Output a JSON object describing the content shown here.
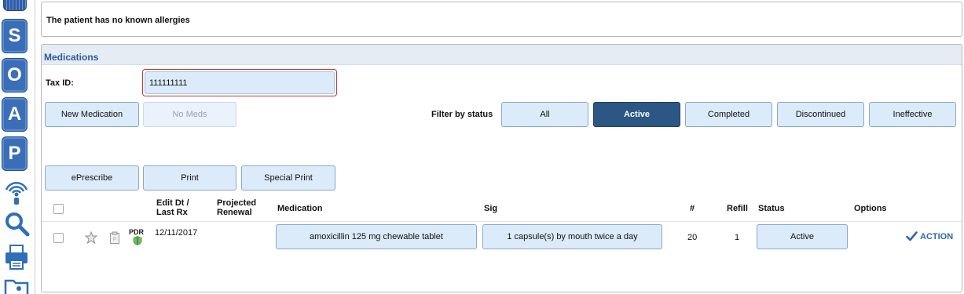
{
  "rail": {
    "soap_letters": [
      "S",
      "O",
      "A",
      "P"
    ],
    "icons": [
      "signal-icon",
      "search-icon",
      "printer-icon",
      "folder-icon"
    ]
  },
  "allergy": {
    "text": "The patient has no known allergies"
  },
  "medications": {
    "title": "Medications",
    "tax_id_label": "Tax ID:",
    "tax_id_value": "111111111",
    "buttons": {
      "new_medication": "New Medication",
      "no_meds": "No Meds",
      "eprescribe": "ePrescribe",
      "print": "Print",
      "special_print": "Special Print"
    },
    "filter": {
      "label": "Filter by status",
      "options": [
        "All",
        "Active",
        "Completed",
        "Discontinued",
        "Ineffective"
      ],
      "selected": "Active"
    },
    "table": {
      "headers": {
        "edit_dt": "Edit Dt /",
        "last_rx": "Last Rx",
        "projected": "Projected",
        "renewal": "Renewal",
        "medication": "Medication",
        "sig": "Sig",
        "count": "#",
        "refill": "Refill",
        "status": "Status",
        "options": "Options"
      },
      "rows": [
        {
          "pdr_label": "PDR",
          "edit_date": "12/11/2017",
          "projected_renewal": "",
          "medication": "amoxicillin 125 mg chewable tablet",
          "sig": "1 capsule(s) by mouth twice a day",
          "count": "20",
          "refill": "1",
          "status": "Active",
          "action_label": "ACTION"
        }
      ]
    }
  },
  "colors": {
    "accent": "#2c5684",
    "button_fill": "#dcebf9",
    "rail_blue": "#3a6fb8",
    "focus_border": "#c0353a",
    "action_blue": "#2c6aa9"
  }
}
